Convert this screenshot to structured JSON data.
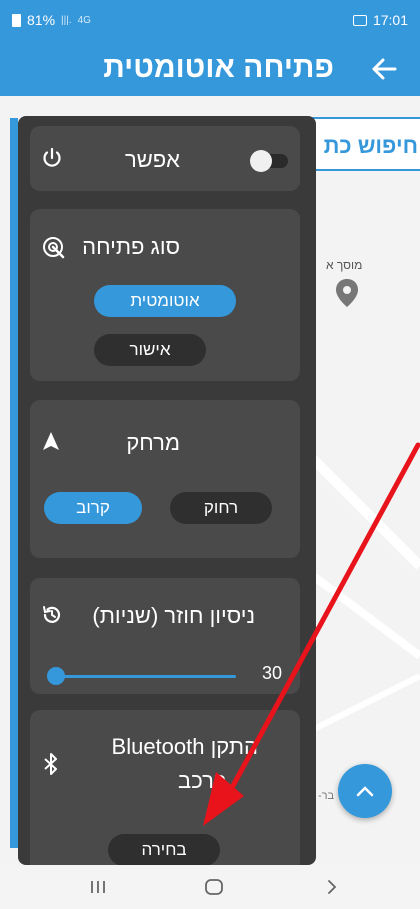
{
  "status_bar": {
    "battery": "81%",
    "signal": "4G",
    "time": "17:01"
  },
  "app_bar": {
    "title": "פתיחה אוטומטית",
    "back_icon": "arrow-left-icon"
  },
  "map": {
    "search_placeholder": "חיפוש כת",
    "place_label": "מוסך א",
    "place_sublabel": "בר-"
  },
  "panel": {
    "enable": {
      "label": "אפשר",
      "icon": "power-icon",
      "toggle_on": false
    },
    "open_type": {
      "title": "סוג פתיחה",
      "icon": "radar-icon",
      "options": [
        "אוטומטית",
        "אישור"
      ],
      "selected": "אוטומטית"
    },
    "distance": {
      "title": "מרחק",
      "icon": "navigation-arrow-icon",
      "options": [
        "קרוב",
        "רחוק"
      ],
      "selected": "קרוב"
    },
    "retry": {
      "title": "ניסיון חוזר (שניות)",
      "icon": "history-icon",
      "value": "30",
      "fraction": 0.0
    },
    "bluetooth": {
      "title_line1": "התקן Bluetooth",
      "title_line2": "ברכב",
      "icon": "bluetooth-icon",
      "select_label": "בחירה"
    }
  },
  "nav": {
    "recent_icon": "recent-apps-icon",
    "home_icon": "home-icon",
    "back_icon": "back-icon"
  },
  "colors": {
    "brand_blue": "#3598db",
    "panel_bg": "#3a3a3a",
    "card_bg": "#4a4a4a",
    "annotation_red": "#e8131b"
  }
}
